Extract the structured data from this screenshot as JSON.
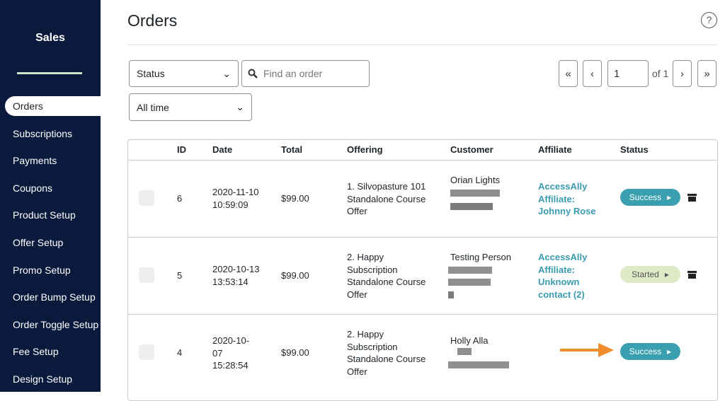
{
  "sidebar": {
    "brand": "Sales",
    "items": [
      {
        "label": "Orders",
        "active": true
      },
      {
        "label": "Subscriptions"
      },
      {
        "label": "Payments"
      },
      {
        "label": "Coupons"
      },
      {
        "label": "Product Setup"
      },
      {
        "label": "Offer Setup"
      },
      {
        "label": "Promo Setup"
      },
      {
        "label": "Order Bump Setup"
      },
      {
        "label": "Order Toggle Setup"
      },
      {
        "label": "Fee Setup"
      },
      {
        "label": "Design Setup"
      }
    ]
  },
  "header": {
    "title": "Orders",
    "help": "?"
  },
  "filters": {
    "status": "Status",
    "search_placeholder": "Find an order",
    "time": "All time"
  },
  "pagination": {
    "first": "«",
    "prev": "‹",
    "page": "1",
    "of": "of 1",
    "next": "›",
    "last": "»"
  },
  "table": {
    "columns": [
      "ID",
      "Date",
      "Total",
      "Offering",
      "Customer",
      "Affiliate",
      "Status"
    ],
    "rows": [
      {
        "id": "6",
        "date": "2020-11-10 10:59:09",
        "total": "$99.00",
        "offering": "1. Silvopasture 101 Standalone Course Offer",
        "customer": "Orian Lights",
        "affiliate": "AccessAlly Affiliate: Johnny Rose",
        "status": "Success"
      },
      {
        "id": "5",
        "date": "2020-10-13 13:53:14",
        "total": "$99.00",
        "offering": "2. Happy Subscription Standalone Course Offer",
        "customer": "Testing Person",
        "affiliate": "AccessAlly Affiliate: Unknown contact (2)",
        "status": "Started"
      },
      {
        "id": "4",
        "date": "2020-10-07 15:28:54",
        "total": "$99.00",
        "offering": "2. Happy Subscription Standalone Course Offer",
        "customer": "Holly Alla",
        "affiliate": "",
        "status": "Success"
      }
    ]
  },
  "colors": {
    "sidebar": "#0a1a3d",
    "success": "#3aa0b0",
    "started": "#dfe9c5",
    "affiliate": "#3a9cb0",
    "arrow": "#f08c2a"
  }
}
